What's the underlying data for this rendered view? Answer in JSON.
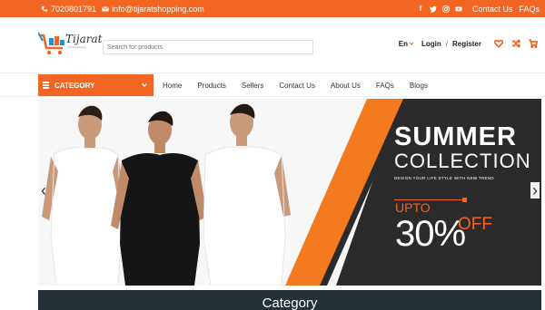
{
  "topbar": {
    "phone": "7020801791",
    "email": "info@tijaratshopping.com",
    "social_icons": [
      "facebook-icon",
      "twitter-icon",
      "instagram-icon",
      "youtube-icon"
    ],
    "contact_us": "Contact Us",
    "faqs": "FAQs"
  },
  "header": {
    "logo_name": "Tijarat",
    "logo_tag": "Tijaratshopping",
    "search_placeholder": "Search for products",
    "lang": "En",
    "login": "Login",
    "separator": "/",
    "register": "Register"
  },
  "nav": {
    "category": "CATEGORY",
    "links": [
      "Home",
      "Products",
      "Sellers",
      "Contact Us",
      "About Us",
      "FAQs",
      "Blogs"
    ]
  },
  "banner": {
    "title1": "SUMMER",
    "title2": "COLLECTION",
    "tagline": "DESIGN YOUR LIFE STYLE WITH NEW TREND",
    "upto": "UPTO",
    "percent": "30%",
    "off": "OFF",
    "prev": "‹",
    "next": "›"
  },
  "section": {
    "title": "Category"
  },
  "colors": {
    "accent": "#f26522",
    "dark": "#2a2a2a",
    "footer_bar": "#243137"
  }
}
